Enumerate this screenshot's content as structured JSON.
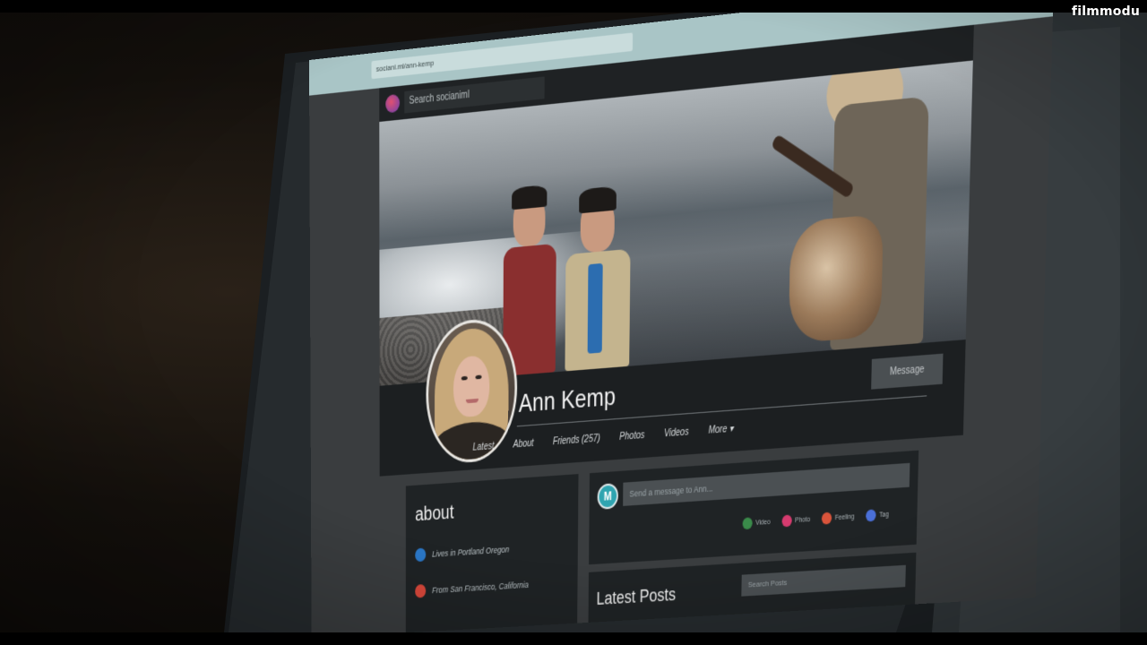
{
  "watermark": "filmmodu",
  "browser": {
    "url": "sociani.ml/ann-kemp"
  },
  "site": {
    "search_placeholder": "Search socianiml"
  },
  "profile": {
    "name": "Ann Kemp",
    "message_button": "Message",
    "tabs": [
      "Latest",
      "About",
      "Friends (257)",
      "Photos",
      "Videos",
      "More ▾"
    ]
  },
  "about": {
    "title": "about",
    "items": [
      {
        "icon": "location-icon",
        "text": "Lives in Portland Oregon",
        "color": "#2b78c8"
      },
      {
        "icon": "home-icon",
        "text": "From San Francisco, California",
        "color": "#d9483b"
      }
    ]
  },
  "compose": {
    "avatar_letter": "M",
    "placeholder": "Send a message to Ann...",
    "actions": [
      {
        "label": "Video",
        "color": "#3a8a4a"
      },
      {
        "label": "Photo",
        "color": "#d63b6f"
      },
      {
        "label": "Feeling",
        "color": "#d9543b"
      },
      {
        "label": "Tag",
        "color": "#4a6fd8"
      }
    ]
  },
  "posts": {
    "title": "Latest Posts",
    "search_placeholder": "Search Posts"
  }
}
